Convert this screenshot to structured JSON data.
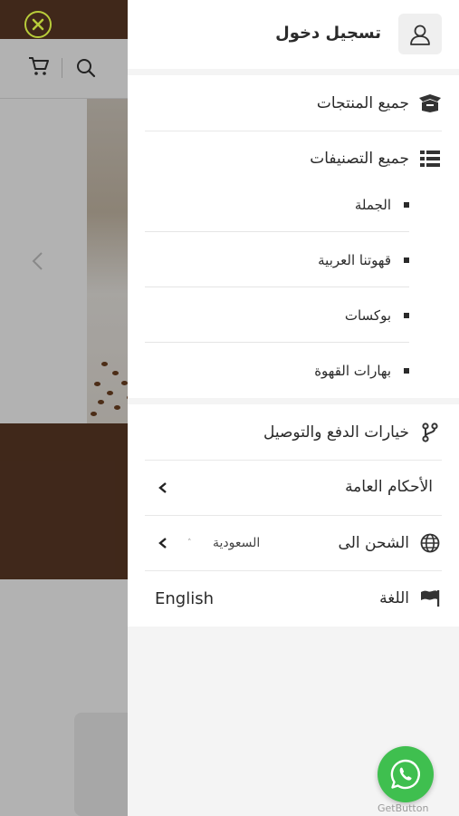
{
  "drawer": {
    "login_label": "تسجيل دخول",
    "all_products": "جميع المنتجات",
    "all_categories": "جميع التصنيفات",
    "categories": [
      "الجملة",
      "قهوتنا العربية",
      "بوكسات",
      "بهارات القهوة"
    ],
    "payment_shipping": "خيارات الدفع والتوصيل",
    "terms": "الأحكام العامة",
    "ship_to": "الشحن الى",
    "ship_country": "السعودية",
    "language_label": "اللغة",
    "language_value": "English"
  },
  "widget": {
    "label": "GetButton"
  },
  "colors": {
    "brown": "#5c3a26",
    "close_ring": "#b8cc3a",
    "whatsapp": "#3fbf4f"
  }
}
